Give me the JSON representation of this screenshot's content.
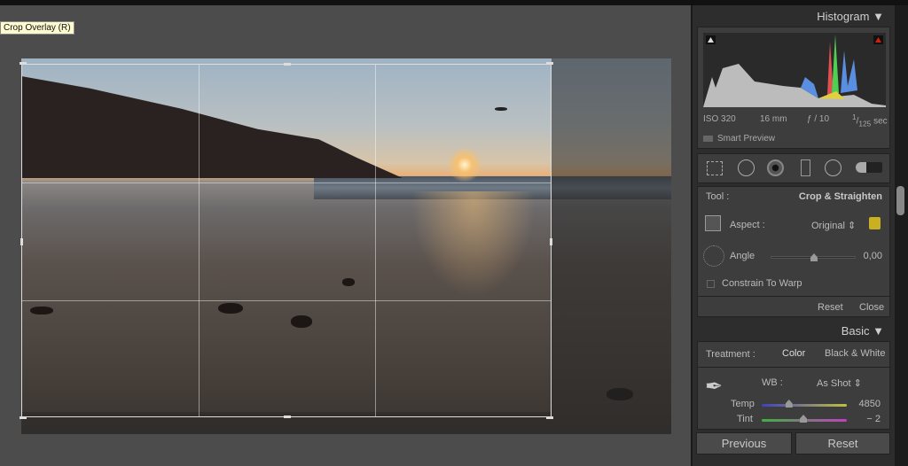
{
  "tooltip": "Crop Overlay (R)",
  "histogram": {
    "title": "Histogram",
    "iso": "ISO 320",
    "focal": "16 mm",
    "aperture": "ƒ / 10",
    "shutter_num": "1",
    "shutter_den": "125",
    "shutter_unit": "sec",
    "smart_preview": "Smart Preview"
  },
  "tools": [
    "crop-overlay",
    "spot-removal",
    "red-eye",
    "graduated-filter",
    "radial-filter",
    "adjustment-brush"
  ],
  "crop": {
    "tool_label": "Tool :",
    "tool_value": "Crop & Straighten",
    "aspect_label": "Aspect :",
    "aspect_value": "Original",
    "angle_label": "Angle",
    "angle_value": "0,00",
    "angle_fraction": 0.5,
    "constrain": "Constrain To Warp",
    "reset": "Reset",
    "close": "Close"
  },
  "basic": {
    "title": "Basic",
    "treatment_label": "Treatment :",
    "color": "Color",
    "bw": "Black & White",
    "wb_label": "WB :",
    "wb_value": "As Shot",
    "temp_label": "Temp",
    "temp_value": "4850",
    "temp_fraction": 0.32,
    "tint_label": "Tint",
    "tint_value": "− 2",
    "tint_fraction": 0.49
  },
  "buttons": {
    "previous": "Previous",
    "reset": "Reset"
  }
}
